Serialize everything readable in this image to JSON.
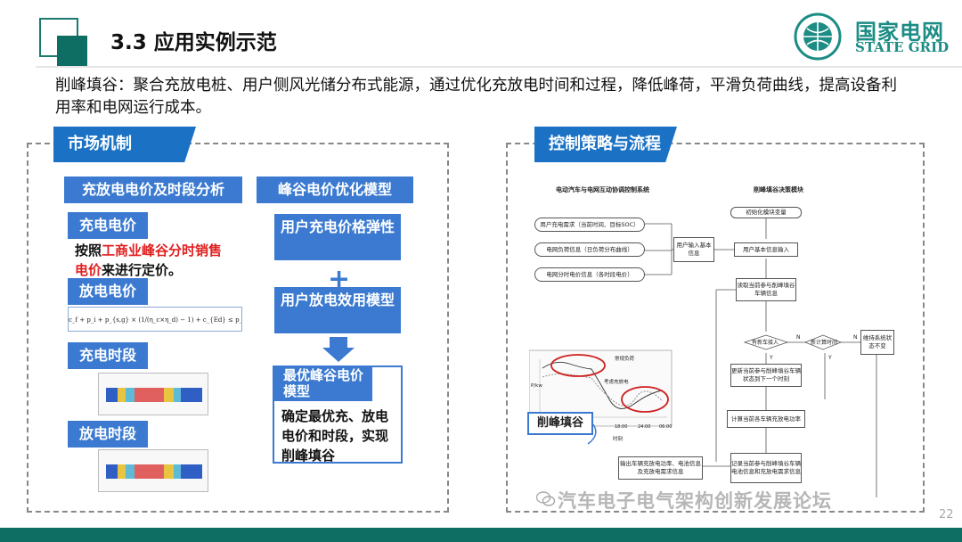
{
  "header": {
    "title": "3.3 应用实例示范",
    "logo_cn": "国家电网",
    "logo_en": "STATE GRID"
  },
  "intro": "削峰填谷：聚合充放电桩、用户侧风光储分布式能源，通过优化充放电时间和过程，降低峰荷，平滑负荷曲线，提高设备利用率和电网运行成本。",
  "left_panel": {
    "tag": "市场机制",
    "header1": "充放电电价及时段分析",
    "header2": "峰谷电价优化模型",
    "charge_price": "充电电价",
    "charge_desc_pre": "按照",
    "charge_desc_red": "工商业峰谷分时销售电价",
    "charge_desc_post": "来进行定价。",
    "discharge_price": "放电电价",
    "formula": "c_f + p_i + p_{s,g} × (1/(η_c×η_d) − 1) + c_{Ed} ≤ p_d ≤ min{p_{same}, p_t}",
    "charge_period": "充电时段",
    "discharge_period": "放电时段",
    "user_charge_elasticity": "用户充电价格弹性",
    "plus": "+",
    "user_discharge_model": "用户放电效用模型",
    "optimal_model": "最优峰谷电价模型",
    "optimal_desc": "确定最优充、放电电价和时段，实现削峰填谷"
  },
  "right_panel": {
    "tag": "控制策略与流程",
    "diagram_title_left": "电动汽车与电网互动协调控制系统",
    "diagram_title_right": "削峰填谷决策模块",
    "inputs": [
      "用户充电需求（当前时间、目标SOC）",
      "电网负荷信息（日负荷分布曲线）",
      "电网分时电价信息（各时段电价）"
    ],
    "user_input": "用户输入基本信息",
    "init": "初始化模块变量",
    "user_info": "用户基本信息输入",
    "read_vehicle": "读取当前参与削峰填谷车辆信息",
    "new_car": "有新车接入",
    "new_period": "新计算时间",
    "keep_state": "维持系统状态不变",
    "update_state": "更新当前参与削峰填谷车辆状态到下一个时刻",
    "compute_power": "计算当前各车辆充放电功率",
    "record": "记录当前参与削峰填谷车辆电池信息和充放电需求信息",
    "output": "输出车辆充放电功率、电池信息及充放电需求信息",
    "n_label": "N",
    "y_label": "Y",
    "chart_legend1": "常规负荷",
    "chart_legend2": "考虑充放电",
    "chart_ylabel": "P/kw",
    "chart_xlabel": "时刻",
    "chart_x1": "18:00",
    "chart_x2": "24:00",
    "chart_x3": "06:00",
    "chart_y": [
      "18",
      "16",
      "14",
      "12",
      "10",
      "8"
    ],
    "callout": "削峰填谷"
  },
  "footer": {
    "watermark": "汽车电子电气架构创新发展论坛",
    "page": "22"
  },
  "colors": {
    "accent_teal": "#0f6e63",
    "brand_teal": "#1c8c85",
    "tag_blue": "#1b72c4",
    "box_blue": "#3b7ad0",
    "highlight_red": "#e02020"
  }
}
